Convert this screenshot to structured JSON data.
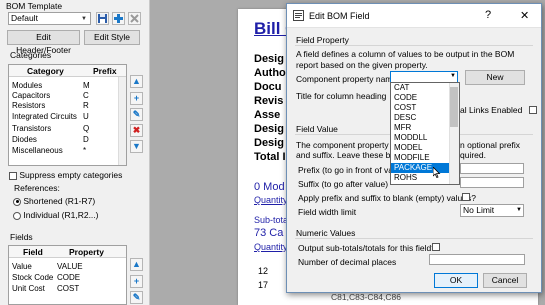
{
  "left_panel": {
    "bom_template_label": "BOM Template",
    "template_value": "Default",
    "edit_header_footer": "Edit Header/Footer",
    "edit_style": "Edit Style",
    "categories_label": "Categories",
    "categories_headers": [
      "Category",
      "Prefix"
    ],
    "categories_rows": [
      {
        "category": "Modules",
        "prefix": "M"
      },
      {
        "category": "Capacitors",
        "prefix": "C"
      },
      {
        "category": "Resistors",
        "prefix": "R"
      },
      {
        "category": "Integrated Circuits",
        "prefix": "U"
      },
      {
        "category": "Transistors",
        "prefix": "Q"
      },
      {
        "category": "Diodes",
        "prefix": "D"
      },
      {
        "category": "Miscellaneous",
        "prefix": "*"
      }
    ],
    "suppress_empty": "Suppress empty categories",
    "references_label": "References:",
    "ref_shortened": "Shortened (R1-R7)",
    "ref_individual": "Individual (R1,R2...)",
    "fields_label": "Fields",
    "fields_headers": [
      "Field",
      "Property"
    ],
    "fields_rows": [
      {
        "field": "Value",
        "property": "VALUE"
      },
      {
        "field": "Stock Code",
        "property": "CODE"
      },
      {
        "field": "Unit Cost",
        "property": "COST"
      }
    ]
  },
  "document": {
    "title": "Bill C",
    "meta_labels": [
      "Desig",
      "Autho",
      "Docu",
      "Revis",
      "Asse",
      "Desig",
      "Desig",
      "Total I"
    ],
    "modules_heading": "0 Mod",
    "quantity_link_1": "Quantity",
    "subtotal_text": "Sub-tota",
    "caps_heading": "73 Ca",
    "quantity_link_2": "Quantity",
    "qty_12": "12",
    "qty_17": "17",
    "refs_text": "C81,C83-C84,C86"
  },
  "dialog": {
    "title": "Edit BOM Field",
    "help_glyph": "?",
    "close_glyph": "✕",
    "field_property_header": "Field Property",
    "field_property_desc": "A field defines a column of values to be output in the BOM report based on the given property.",
    "component_prop_label": "Component property name",
    "new_button": "New",
    "title_col_label": "Title for column heading",
    "links_enabled_label": "al Links Enabled",
    "field_value_header": "Field Value",
    "field_value_desc_1": "The component property valu",
    "field_value_desc_1b": "n optional prefix",
    "field_value_desc_2": "and suffix. Leave these bla",
    "field_value_desc_2b": "quired.",
    "prefix_label": "Prefix (to go in front of valu",
    "suffix_label": "Suffix (to go after value)",
    "apply_prefix_label": "Apply prefix and suffix to blank (empty) values?",
    "field_width_label": "Field width limit",
    "field_width_value": "No Limit",
    "numeric_header": "Numeric Values",
    "output_subtotals_label": "Output sub-totals/totals for this field?",
    "decimal_places_label": "Number of decimal places",
    "ok_button": "OK",
    "cancel_button": "Cancel",
    "dropdown_options": [
      "CAT",
      "CODE",
      "COST",
      "DESC",
      "MFR",
      "MODDLL",
      "MODEL",
      "MODFILE",
      "PACKAGE",
      "ROHS"
    ],
    "dropdown_selected": "PACKAGE"
  },
  "colors": {
    "link_blue": "#1f1fa8",
    "selection_blue": "#0078d7",
    "title_bar_bg": "#ffffff",
    "panel_bg": "#f0f0f0",
    "backdrop": "#ababab"
  }
}
